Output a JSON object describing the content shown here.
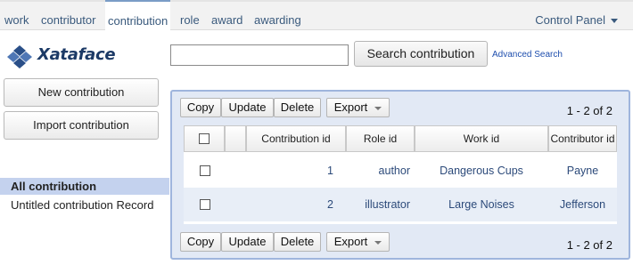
{
  "topnav": {
    "tabs": [
      {
        "label": "work"
      },
      {
        "label": "contributor"
      },
      {
        "label": "contribution",
        "active": true
      },
      {
        "label": "role"
      },
      {
        "label": "award"
      },
      {
        "label": "awarding"
      }
    ],
    "control_panel": "Control Panel"
  },
  "logo": {
    "text": "Xataface"
  },
  "search": {
    "value": "",
    "button": "Search contribution",
    "advanced": "Advanced Search"
  },
  "sidebar": {
    "new_button": "New contribution",
    "import_button": "Import contribution",
    "items": [
      {
        "label": "All contribution",
        "selected": true
      },
      {
        "label": "Untitled contribution Record"
      }
    ]
  },
  "toolbar": {
    "copy": "Copy",
    "update": "Update",
    "delete": "Delete",
    "export": "Export",
    "count": "1 - 2 of 2"
  },
  "table": {
    "columns": [
      "Contribution id",
      "Role id",
      "Work id",
      "Contributor id"
    ],
    "rows": [
      {
        "contribution_id": "1",
        "role_id": "author",
        "work_id": "Dangerous Cups",
        "contributor_id": "Payne"
      },
      {
        "contribution_id": "2",
        "role_id": "illustrator",
        "work_id": "Large Noises",
        "contributor_id": "Jefferson"
      }
    ]
  },
  "colors": {
    "accent": "#9fb5dd",
    "selected": "#c4d2ee",
    "link": "#3a5a7d"
  }
}
